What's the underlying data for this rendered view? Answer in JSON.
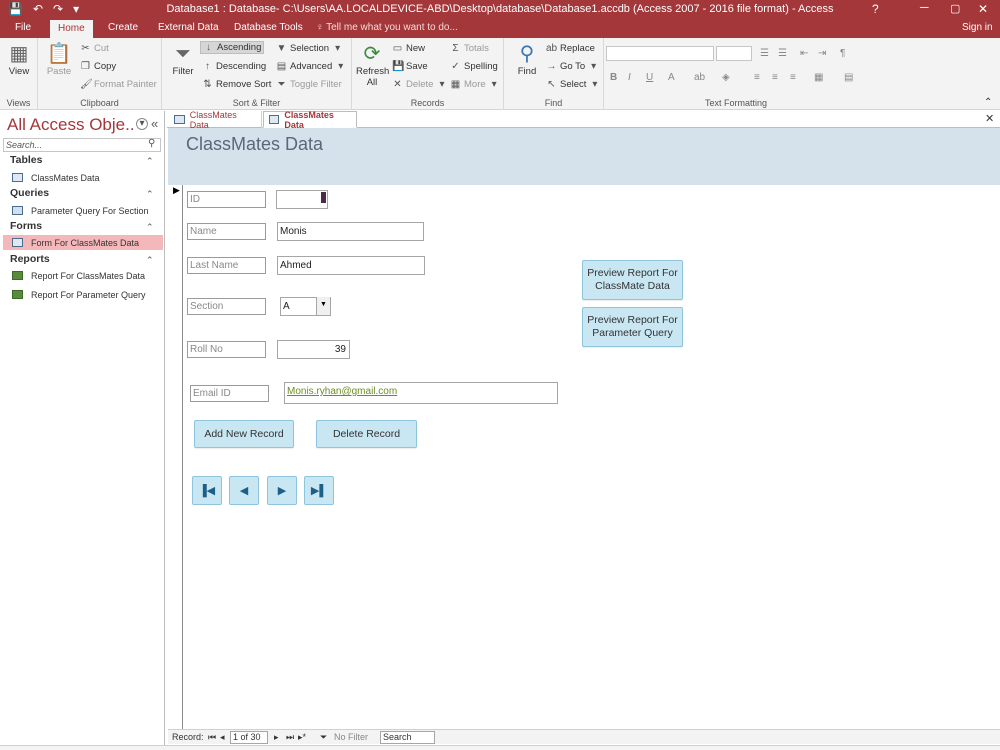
{
  "window": {
    "title": "Database1 : Database- C:\\Users\\AA.LOCALDEVICE-ABD\\Desktop\\database\\Database1.accdb (Access 2007 - 2016 file format) - Access",
    "help": "?",
    "qat": [
      "💾",
      "↶",
      "↷",
      "▾"
    ],
    "minimize": "─",
    "maximize": "▢",
    "close": "✕"
  },
  "tabs": {
    "file": "File",
    "home": "Home",
    "create": "Create",
    "external": "External Data",
    "dbtools": "Database Tools",
    "tellme": "♀ Tell me what you want to do...",
    "signin": "Sign in"
  },
  "ribbon": {
    "views": {
      "view": "View",
      "label": "Views"
    },
    "clipboard": {
      "paste": "Paste",
      "cut": "Cut",
      "copy": "Copy",
      "format_painter": "Format Painter",
      "label": "Clipboard"
    },
    "sort_filter": {
      "filter": "Filter",
      "ascending": "Ascending",
      "descending": "Descending",
      "remove_sort": "Remove Sort",
      "selection": "Selection",
      "advanced": "Advanced",
      "toggle_filter": "Toggle Filter",
      "label": "Sort & Filter"
    },
    "records": {
      "refresh_all": "Refresh All",
      "new": "New",
      "save": "Save",
      "delete": "Delete",
      "totals": "Totals",
      "spelling": "Spelling",
      "more": "More",
      "label": "Records"
    },
    "find": {
      "find": "Find",
      "replace": "Replace",
      "goto": "Go To",
      "select": "Select",
      "label": "Find"
    },
    "text_formatting": {
      "label": "Text Formatting"
    }
  },
  "nav": {
    "title": "All Access Obje...",
    "search_placeholder": "Search...",
    "categories": [
      {
        "name": "Tables",
        "items": [
          "ClassMates Data"
        ]
      },
      {
        "name": "Queries",
        "items": [
          "Parameter Query For Section"
        ]
      },
      {
        "name": "Forms",
        "items": [
          "Form For ClassMates Data"
        ]
      },
      {
        "name": "Reports",
        "items": [
          "Report For ClassMates Data",
          "Report For Parameter Query"
        ]
      }
    ]
  },
  "doc_tabs": [
    "ClassMates Data",
    "ClassMates Data"
  ],
  "form": {
    "title": "ClassMates Data",
    "fields": {
      "id": {
        "label": "ID",
        "value": ""
      },
      "name": {
        "label": "Name",
        "value": "Monis"
      },
      "last_name": {
        "label": "Last Name",
        "value": "Ahmed"
      },
      "section": {
        "label": "Section",
        "value": "A"
      },
      "roll_no": {
        "label": "Roll No",
        "value": "39"
      },
      "email": {
        "label": "Email ID",
        "value": "Monis.ryhan@gmail.com"
      }
    },
    "buttons": {
      "preview_classmate": "Preview Report For ClassMate Data",
      "preview_parameter": "Preview Report For Parameter Query",
      "add_record": "Add New Record",
      "delete_record": "Delete Record"
    }
  },
  "record_nav": {
    "label": "Record:",
    "position": "1 of 30",
    "filter": "No Filter",
    "search": "Search"
  },
  "colors": {
    "brand": "#a4373a",
    "form_header": "#d5e2ec",
    "button": "#c9e6f3",
    "nav_active": "#f4b8bb"
  }
}
